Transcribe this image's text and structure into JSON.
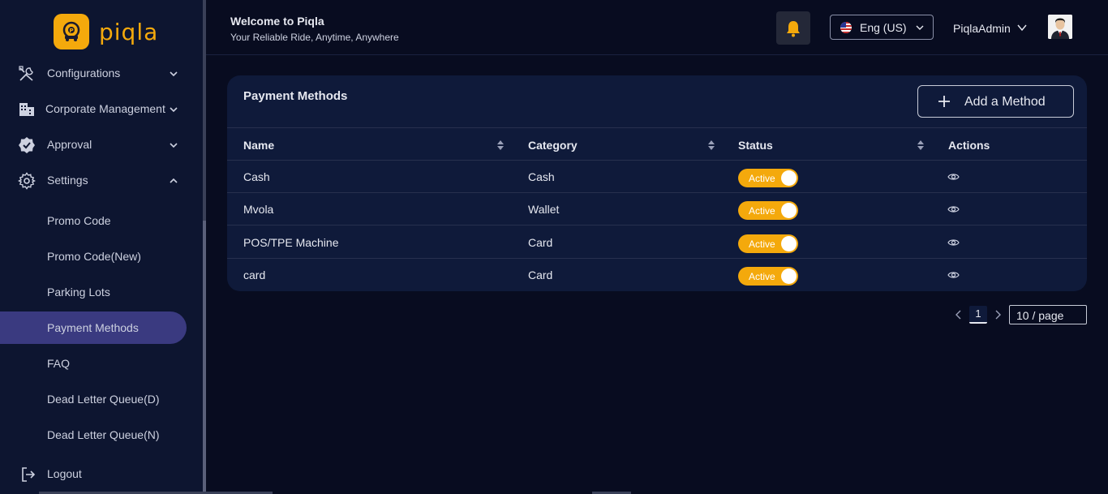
{
  "brand": {
    "name": "piqla",
    "accent": "#f4a90c"
  },
  "sidebar": {
    "groups": [
      {
        "label": "Configurations",
        "icon": "tools-icon",
        "expanded": false
      },
      {
        "label": "Corporate Management",
        "icon": "building-icon",
        "expanded": false
      },
      {
        "label": "Approval",
        "icon": "badge-check-icon",
        "expanded": false
      },
      {
        "label": "Settings",
        "icon": "gear-icon",
        "expanded": true
      }
    ],
    "settings_items": [
      "Promo Code",
      "Promo Code(New)",
      "Parking Lots",
      "Payment Methods",
      "FAQ",
      "Dead Letter Queue(D)",
      "Dead Letter Queue(N)"
    ],
    "active_item": "Payment Methods",
    "logout_label": "Logout"
  },
  "header": {
    "title": "Welcome to Piqla",
    "subtitle": "Your Reliable Ride, Anytime, Anywhere",
    "language": "Eng (US)",
    "user": "PiqlaAdmin"
  },
  "card": {
    "title": "Payment Methods",
    "add_label": "Add a Method",
    "columns": [
      "Name",
      "Category",
      "Status",
      "Actions"
    ],
    "rows": [
      {
        "name": "Cash",
        "category": "Cash",
        "status": "Active"
      },
      {
        "name": "Mvola",
        "category": "Wallet",
        "status": "Active"
      },
      {
        "name": "POS/TPE Machine",
        "category": "Card",
        "status": "Active"
      },
      {
        "name": "card",
        "category": "Card",
        "status": "Active"
      }
    ]
  },
  "pagination": {
    "page": "1",
    "page_size": "10 / page"
  }
}
